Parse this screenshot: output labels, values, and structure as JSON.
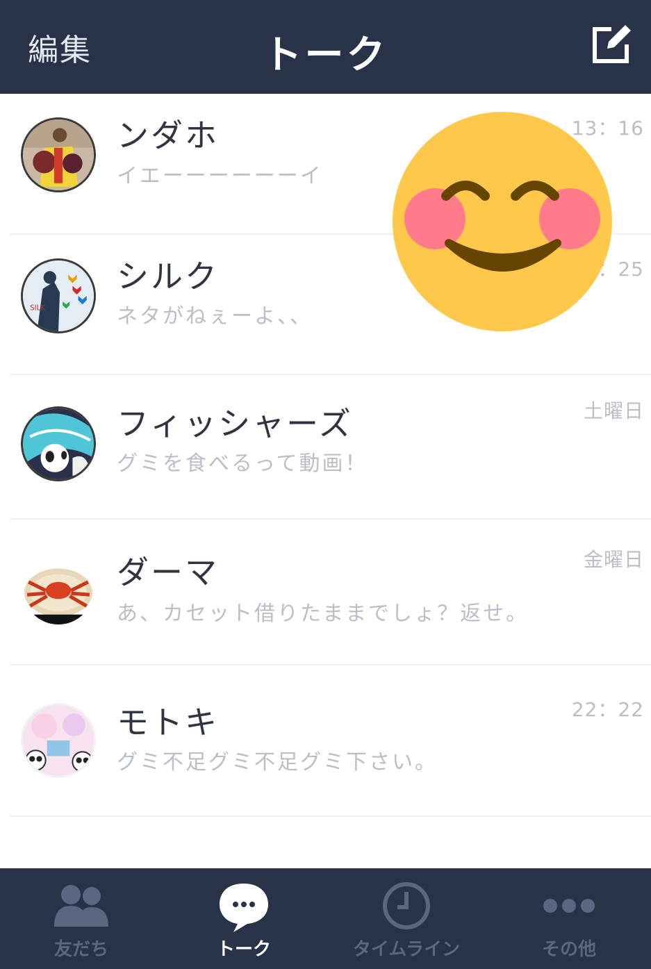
{
  "header": {
    "edit_label": "編集",
    "title": "トーク",
    "compose_icon": "compose-icon"
  },
  "chats": [
    {
      "name": "ンダホ",
      "message": "イエーーーーーーイ",
      "time": "13：16"
    },
    {
      "name": "シルク",
      "message": "ネタがねぇーよ、、",
      "time": "：25"
    },
    {
      "name": "フィッシャーズ",
      "message": "グミを食べるって動画！",
      "time": "土曜日"
    },
    {
      "name": "ダーマ",
      "message": "あ、カセット借りたままでしょ？返せ。",
      "time": "金曜日"
    },
    {
      "name": "モトキ",
      "message": "グミ不足グミ不足グミ下さい。",
      "time": "22：22"
    }
  ],
  "tabbar": {
    "tabs": [
      {
        "label": "友だち",
        "icon": "friends-icon"
      },
      {
        "label": "トーク",
        "icon": "chat-bubble-icon"
      },
      {
        "label": "タイムライン",
        "icon": "clock-icon"
      },
      {
        "label": "その他",
        "icon": "more-dots-icon"
      }
    ],
    "active_tab": "トーク"
  },
  "colors": {
    "bar": "#283248",
    "text_primary": "#2f3440",
    "text_secondary": "#b9bec7",
    "tab_inactive": "#5d6680"
  }
}
